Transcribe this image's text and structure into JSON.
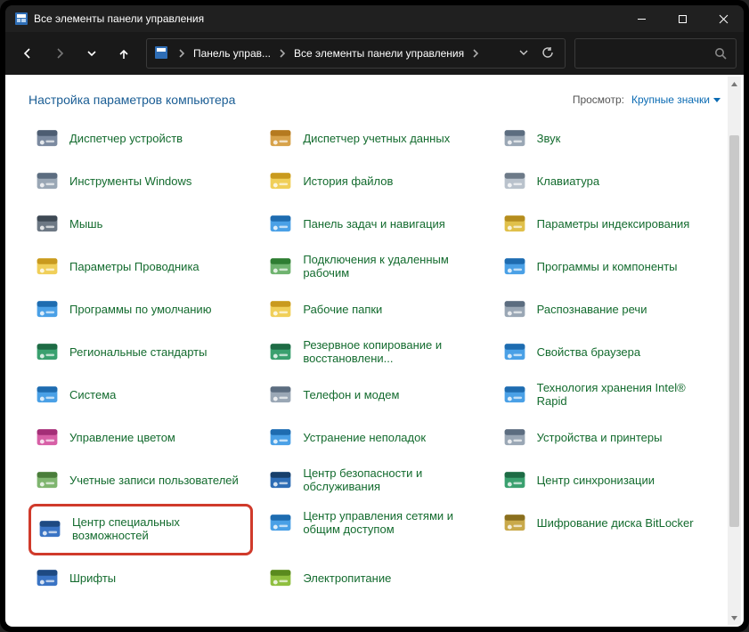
{
  "window": {
    "title": "Все элементы панели управления"
  },
  "breadcrumbs": {
    "b1": "Панель управ...",
    "b2": "Все элементы панели управления"
  },
  "header": {
    "title": "Настройка параметров компьютера",
    "view_label": "Просмотр:",
    "view_value": "Крупные значки"
  },
  "grid": {
    "r0": {
      "c0": "Диспетчер устройств",
      "c1": "Диспетчер учетных данных",
      "c2": "Звук"
    },
    "r1": {
      "c0": "Инструменты Windows",
      "c1": "История файлов",
      "c2": "Клавиатура"
    },
    "r2": {
      "c0": "Мышь",
      "c1": "Панель задач и навигация",
      "c2": "Параметры индексирования"
    },
    "r3": {
      "c0": "Параметры Проводника",
      "c1": "Подключения к удаленным рабочим",
      "c2": "Программы и компоненты"
    },
    "r4": {
      "c0": "Программы по умолчанию",
      "c1": "Рабочие папки",
      "c2": "Распознавание речи"
    },
    "r5": {
      "c0": "Региональные стандарты",
      "c1": "Резервное копирование и восстановлени...",
      "c2": "Свойства браузера"
    },
    "r6": {
      "c0": "Система",
      "c1": "Телефон и модем",
      "c2": "Технология хранения Intel® Rapid"
    },
    "r7": {
      "c0": "Управление цветом",
      "c1": "Устранение неполадок",
      "c2": "Устройства и принтеры"
    },
    "r8": {
      "c0": "Учетные записи пользователей",
      "c1": "Центр безопасности и обслуживания",
      "c2": "Центр синхронизации"
    },
    "r9": {
      "c0": "Центр специальных возможностей",
      "c1": "Центр управления сетями и общим доступом",
      "c2": "Шифрование диска BitLocker"
    },
    "r10": {
      "c0": "Шрифты",
      "c1": "Электропитание",
      "c2": ""
    }
  },
  "highlight": {
    "row": 9,
    "col": 0
  }
}
